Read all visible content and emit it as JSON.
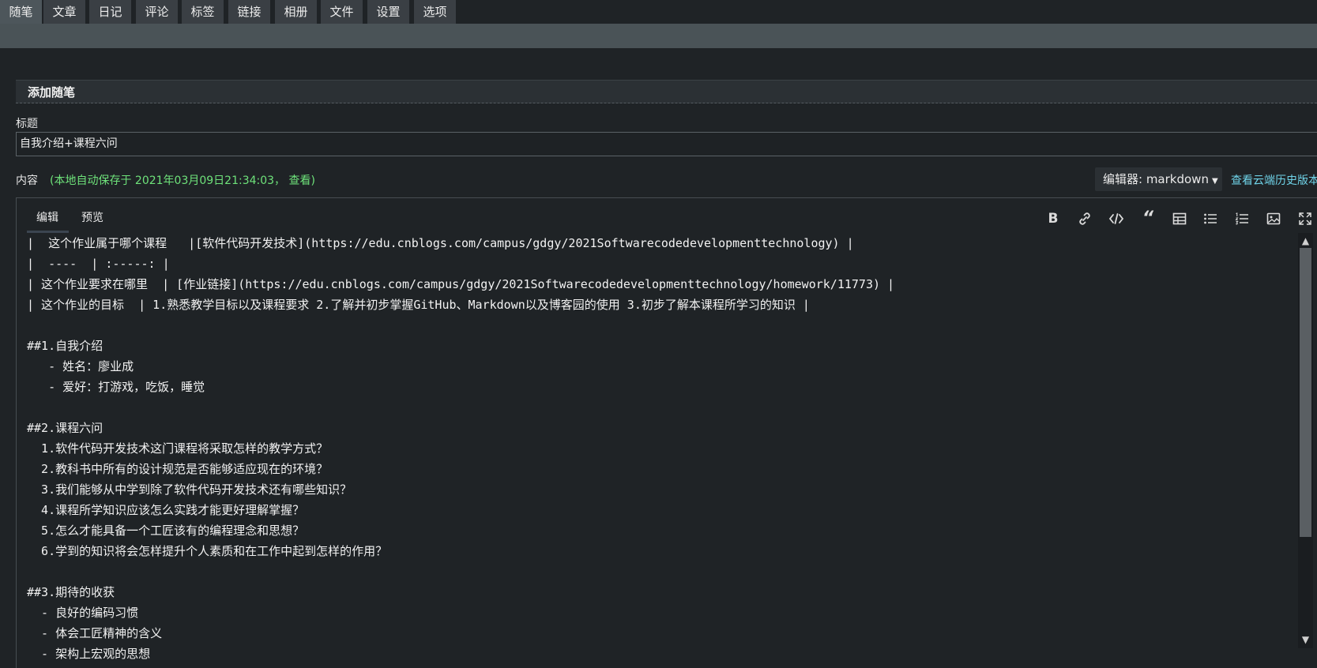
{
  "nav": {
    "tabs": [
      {
        "label": "随笔",
        "active": true
      },
      {
        "label": "文章"
      },
      {
        "label": "日记"
      },
      {
        "label": "评论"
      },
      {
        "label": "标签"
      },
      {
        "label": "链接"
      },
      {
        "label": "相册"
      },
      {
        "label": "文件"
      },
      {
        "label": "设置"
      },
      {
        "label": "选项"
      }
    ]
  },
  "panel": {
    "title": "添加随笔",
    "title_label": "标题",
    "title_value": "自我介绍+课程六问",
    "content_label": "内容",
    "autosave_text": "(本地自动保存于 2021年03月09日21:34:03，",
    "autosave_view": "查看",
    "autosave_end": ")",
    "editor_select": "编辑器: markdown",
    "cloud_history": "查看云端历史版本"
  },
  "editor": {
    "tab_edit": "编辑",
    "tab_preview": "预览",
    "toolbar_icons": [
      "bold-icon",
      "link-icon",
      "code-icon",
      "quote-icon",
      "table-icon",
      "bullet-list-icon",
      "numbered-list-icon",
      "image-icon",
      "fullscreen-icon"
    ],
    "lines": [
      "|  这个作业属于哪个课程   |[软件代码开发技术](https://edu.cnblogs.com/campus/gdgy/2021Softwarecodedevelopmenttechnology) |",
      "|  ----  | :-----: |",
      "| 这个作业要求在哪里  | [作业链接](https://edu.cnblogs.com/campus/gdgy/2021Softwarecodedevelopmenttechnology/homework/11773) |",
      "| 这个作业的目标  | 1.熟悉教学目标以及课程要求 2.了解并初步掌握GitHub、Markdown以及博客园的使用 3.初步了解本课程所学习的知识 |",
      "",
      "##1.自我介绍",
      "   - 姓名：廖业成",
      "   - 爱好：打游戏，吃饭，睡觉",
      "",
      "##2.课程六问",
      "  1.软件代码开发技术这门课程将采取怎样的教学方式？",
      "  2.教科书中所有的设计规范是否能够适应现在的环境？",
      "  3.我们能够从中学到除了软件代码开发技术还有哪些知识？",
      "  4.课程所学知识应该怎么实践才能更好理解掌握？",
      "  5.怎么才能具备一个工匠该有的编程理念和思想？",
      "  6.学到的知识将会怎样提升个人素质和在工作中起到怎样的作用？",
      "",
      "##3.期待的收获",
      "  - 良好的编码习惯",
      "  - 体会工匠精神的含义",
      "  - 架构上宏观的思想"
    ]
  }
}
